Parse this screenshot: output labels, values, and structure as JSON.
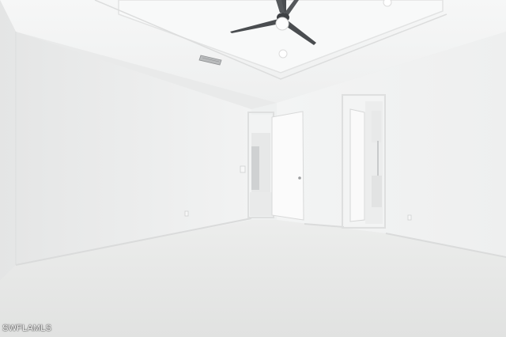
{
  "watermark": {
    "text": "SWFLAMLS"
  },
  "colors": {
    "ceiling": "#f4f5f5",
    "wall": "#eeefef",
    "floor": "#e6e7e6",
    "door": "#fbfbfb",
    "fan": "#4a4d50"
  }
}
